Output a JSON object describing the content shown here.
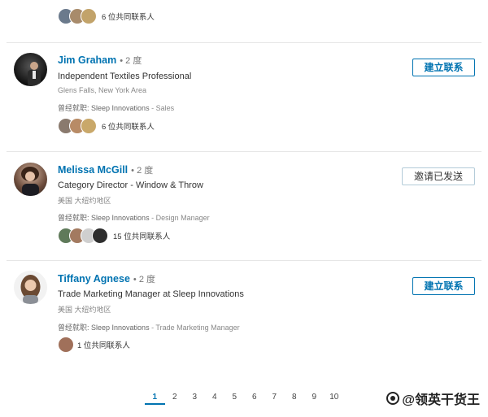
{
  "top_partial": {
    "shared_connections": "6 位共同联系人"
  },
  "people": [
    {
      "name": "Jim Graham",
      "degree": "• 2 度",
      "headline": "Independent Textiles Professional",
      "location": "Glens Falls, New York Area",
      "past_prefix": "曾经就职: ",
      "past_company": "Sleep Innovations",
      "past_role": " - Sales",
      "shared_connections": "6 位共同联系人",
      "action_label": "建立联系",
      "action_state": "connect"
    },
    {
      "name": "Melissa McGill",
      "degree": "• 2 度",
      "headline": "Category Director - Window & Throw",
      "location": "美国 大纽约地区",
      "past_prefix": "曾经就职: ",
      "past_company": "Sleep Innovations",
      "past_role": " - Design Manager",
      "shared_connections": "15 位共同联系人",
      "action_label": "邀请已发送",
      "action_state": "sent"
    },
    {
      "name": "Tiffany Agnese",
      "degree": "• 2 度",
      "headline": "Trade Marketing Manager at Sleep Innovations",
      "location": "美国 大纽约地区",
      "past_prefix": "曾经就职: ",
      "past_company": "Sleep Innovations",
      "past_role": " - Trade Marketing Manager",
      "shared_connections": "1 位共同联系人",
      "action_label": "建立联系",
      "action_state": "connect"
    }
  ],
  "pagination": {
    "pages": [
      "1",
      "2",
      "3",
      "4",
      "5",
      "6",
      "7",
      "8",
      "9",
      "10"
    ],
    "current": "1"
  },
  "watermark": "@领英干货王",
  "colors": {
    "link": "#0073b1",
    "separator": "#e6e6e6"
  }
}
